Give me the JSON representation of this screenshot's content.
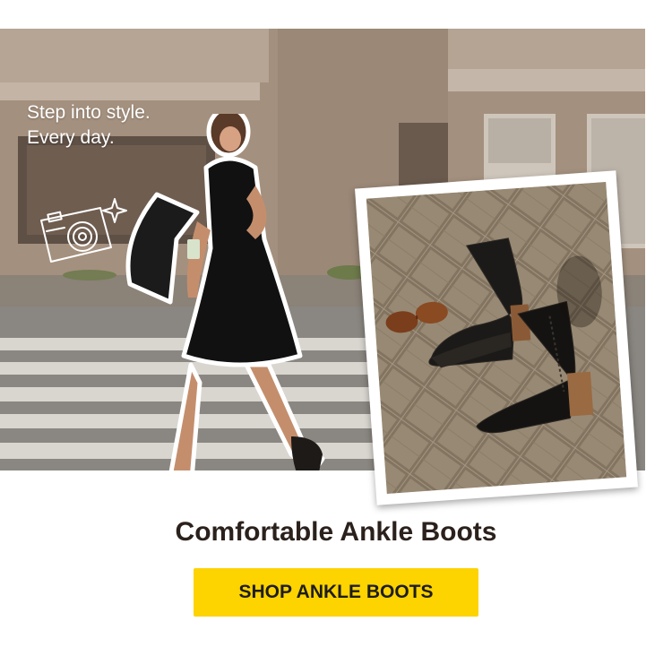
{
  "hero": {
    "tagline_line1": "Step into style.",
    "tagline_line2": "Every day."
  },
  "headline": "Comfortable Ankle Boots",
  "cta": {
    "label": "SHOP ANKLE BOOTS"
  },
  "icons": [
    "camera-icon",
    "sparkle-icon"
  ],
  "colors": {
    "cta_background": "#fdd300",
    "headline_text": "#2b211c",
    "background": "#ffffff"
  }
}
